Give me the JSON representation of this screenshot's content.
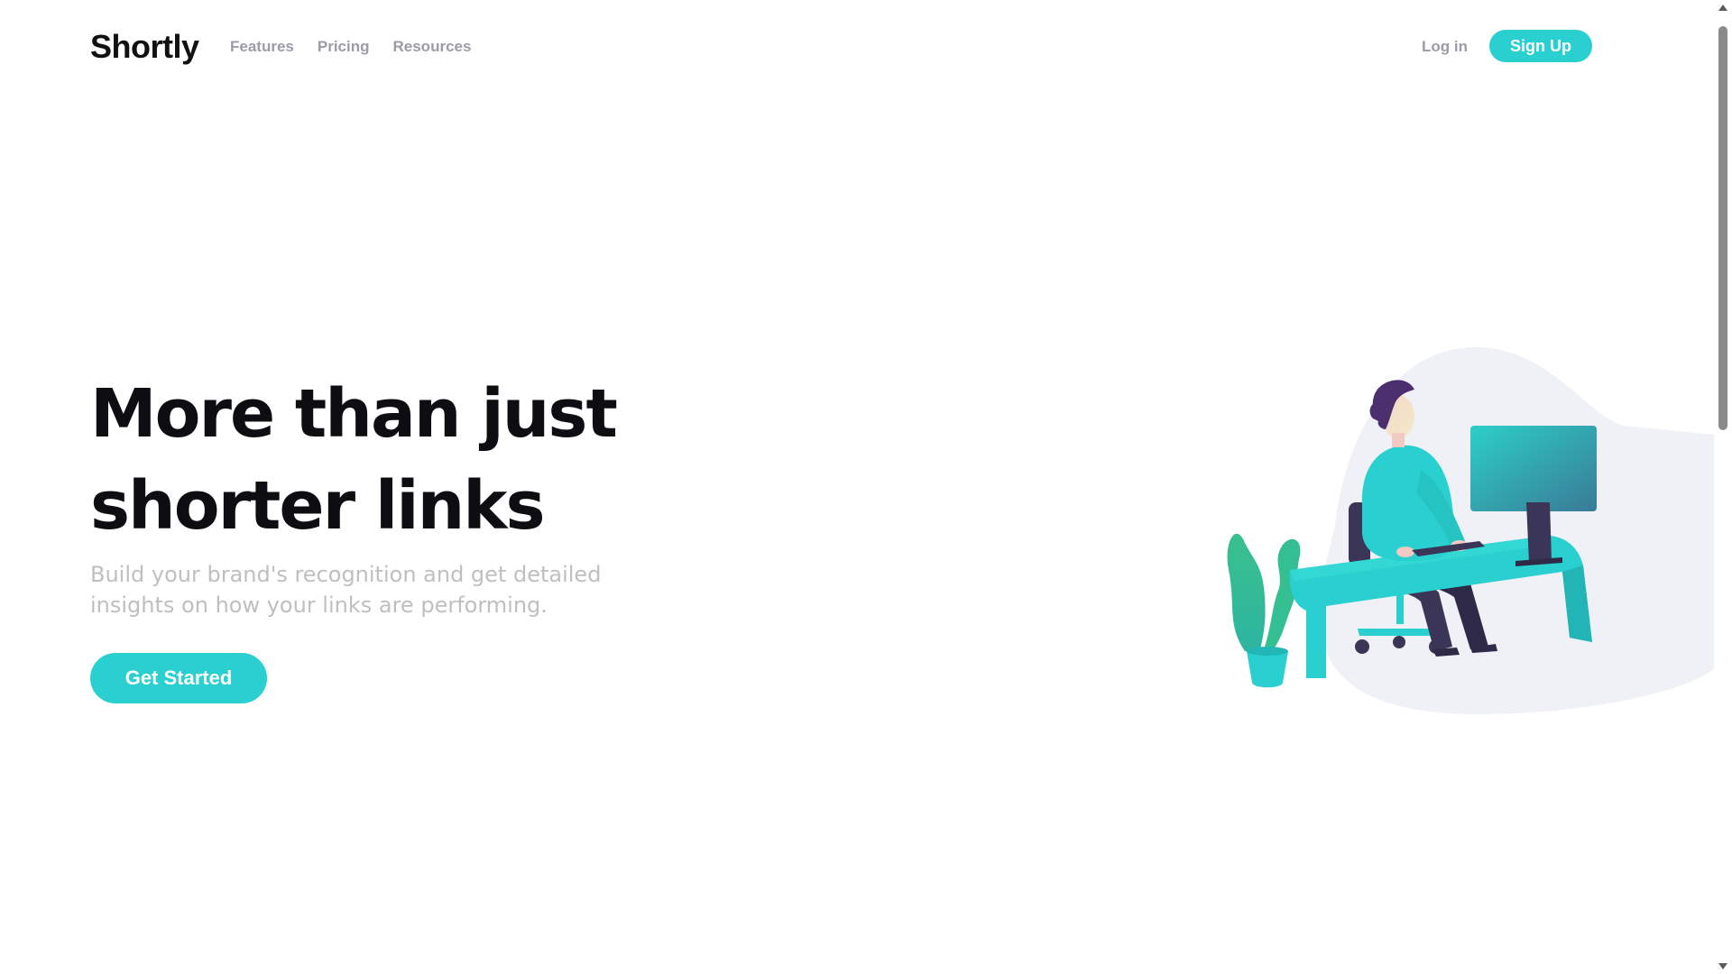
{
  "brand": {
    "name": "Shortly",
    "accent_color": "#2acfcf",
    "text_color": "#0e0e12",
    "muted_color": "#9e9aa8"
  },
  "nav": {
    "links": [
      {
        "label": "Features"
      },
      {
        "label": "Pricing"
      },
      {
        "label": "Resources"
      }
    ],
    "login_label": "Log in",
    "signup_label": "Sign Up"
  },
  "hero": {
    "title_line1": "More than just",
    "title_line2": "shorter links",
    "subtitle": "Build your brand's recognition and get detailed insights on how your links are performing.",
    "cta_label": "Get Started",
    "illustration": "person-working-at-desk-illustration"
  },
  "scrollbar": {
    "up_icon": "triangle-up-icon",
    "down_icon": "triangle-down-icon"
  }
}
